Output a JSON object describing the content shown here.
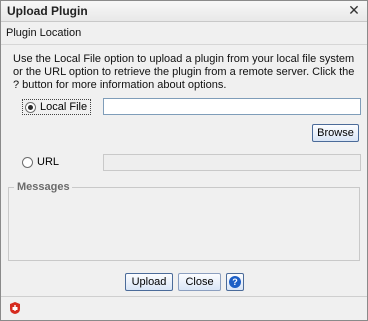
{
  "window": {
    "title": "Upload Plugin",
    "close_glyph": "✕"
  },
  "section": {
    "heading": "Plugin Location",
    "description": "Use the Local File option to upload a plugin from your local file system or the URL option to retrieve the plugin from a remote server. Click the ? button for more information about options."
  },
  "local_file": {
    "label": "Local File",
    "selected": true,
    "path_value": "",
    "browse_label": "Browse"
  },
  "url_option": {
    "label": "URL",
    "selected": false,
    "url_value": ""
  },
  "messages": {
    "title": "Messages"
  },
  "buttons": {
    "upload": "Upload",
    "close": "Close",
    "help_glyph": "?"
  },
  "colors": {
    "dialog_bg": "#f0f0f0",
    "button_border": "#4b6b99",
    "help_blue": "#1d5fc6",
    "logo_red": "#d62b1f"
  },
  "icons": {
    "close": "close-icon",
    "help": "help-icon",
    "logo": "app-logo-icon"
  }
}
